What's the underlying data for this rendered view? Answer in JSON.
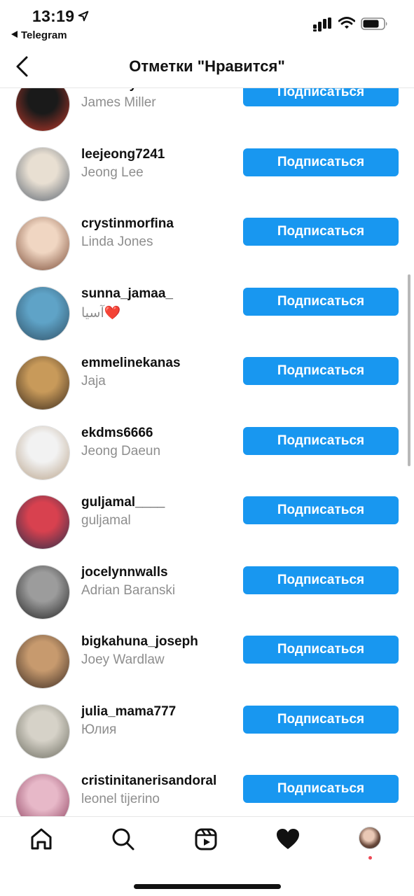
{
  "status_bar": {
    "time": "13:19",
    "back_app": "Telegram"
  },
  "header": {
    "title": "Отметки \"Нравится\""
  },
  "users": [
    {
      "username": "sluelway",
      "full_name": "James Miller",
      "follow_label": "Подписаться",
      "avatar_colors": [
        "#1a1a1a",
        "#c0392b"
      ]
    },
    {
      "username": "leejeong7241",
      "full_name": "Jeong  Lee",
      "follow_label": "Подписаться",
      "avatar_colors": [
        "#e8dfd2",
        "#5a6470"
      ]
    },
    {
      "username": "crystinmorfina",
      "full_name": "Linda Jones",
      "follow_label": "Подписаться",
      "avatar_colors": [
        "#f0d6c2",
        "#7a4a35"
      ]
    },
    {
      "username": "sunna_jamaa_",
      "full_name": "آسیا❤️",
      "follow_label": "Подписаться",
      "avatar_colors": [
        "#5fa3c7",
        "#2f4f64"
      ]
    },
    {
      "username": "emmelinekanas",
      "full_name": "Jaja",
      "follow_label": "Подписаться",
      "avatar_colors": [
        "#c89a5a",
        "#3a2a1c"
      ]
    },
    {
      "username": "ekdms6666",
      "full_name": "Jeong Daeun",
      "follow_label": "Подписаться",
      "avatar_colors": [
        "#f2f2f2",
        "#b9a38a"
      ]
    },
    {
      "username": "guljamal____",
      "full_name": "guljamal",
      "follow_label": "Подписаться",
      "avatar_colors": [
        "#d8414f",
        "#2b2f4a"
      ]
    },
    {
      "username": "jocelynnwalls",
      "full_name": "Adrian Baranski",
      "follow_label": "Подписаться",
      "avatar_colors": [
        "#9c9c9c",
        "#222222"
      ]
    },
    {
      "username": "bigkahuna_joseph",
      "full_name": "Joey Wardlaw",
      "follow_label": "Подписаться",
      "avatar_colors": [
        "#c79a6e",
        "#3b2b22"
      ]
    },
    {
      "username": "julia_mama777",
      "full_name": "Юлия",
      "follow_label": "Подписаться",
      "avatar_colors": [
        "#d6d2c8",
        "#6b6b5f"
      ]
    },
    {
      "username": "cristinitanerisandoral",
      "full_name": "leonel tijerino",
      "follow_label": "Подписаться",
      "avatar_colors": [
        "#e7b8c8",
        "#8a3b5a"
      ]
    }
  ],
  "tab_bar": {
    "tabs": [
      {
        "icon": "home-icon"
      },
      {
        "icon": "search-icon"
      },
      {
        "icon": "reels-icon"
      },
      {
        "icon": "heart-icon"
      },
      {
        "icon": "profile-avatar"
      }
    ]
  },
  "colors": {
    "follow_button": "#1897f0",
    "secondary_text": "#8e8e8e",
    "notification_dot": "#ed4956"
  }
}
